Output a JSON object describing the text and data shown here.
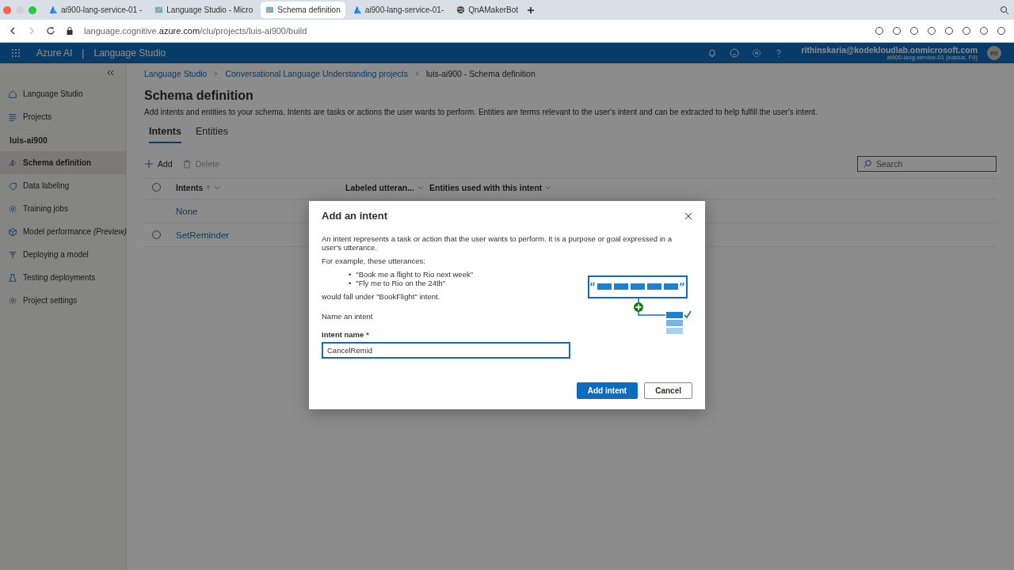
{
  "browser": {
    "tabs": [
      {
        "title": "ai900-lang-service-01 -",
        "kind": "azure",
        "selected": false
      },
      {
        "title": "Language Studio - Micro",
        "kind": "studio",
        "selected": false
      },
      {
        "title": "Schema definition",
        "kind": "studio",
        "selected": true
      },
      {
        "title": "ai900-lang-service-01-",
        "kind": "azure",
        "selected": false
      },
      {
        "title": "QnAMakerBot",
        "kind": "globe",
        "selected": false
      }
    ],
    "url": "language.cognitive.**azure.com**/clu/projects/luis-ai900/build"
  },
  "header": {
    "brand": "Azure AI",
    "separator": "|",
    "product": "Language Studio",
    "user_email": "rithinskaria@kodekloudlab.onmicrosoft.com",
    "user_detail": "ai900-lang-service-01 (eastus, F0)",
    "avatar": "RS"
  },
  "sidebar": {
    "items": [
      {
        "kind": "home",
        "label": "Language Studio",
        "selected": false
      },
      {
        "kind": "list",
        "label": "Projects",
        "selected": false
      },
      {
        "kind": "heading",
        "label": "luis-ai900"
      },
      {
        "kind": "schema",
        "label": "Schema definition",
        "selected": true
      },
      {
        "kind": "tag",
        "label": "Data labeling",
        "selected": false
      },
      {
        "kind": "gear",
        "label": "Training jobs",
        "selected": false
      },
      {
        "kind": "cube",
        "label": "Model performance *(Preview)*",
        "selected": false
      },
      {
        "kind": "deploy",
        "label": "Deploying a model",
        "selected": false
      },
      {
        "kind": "flask",
        "label": "Testing deployments",
        "selected": false
      },
      {
        "kind": "gear",
        "label": "Project settings",
        "selected": false
      }
    ]
  },
  "breadcrumb": [
    {
      "label": "Language Studio",
      "link": true
    },
    {
      "label": "Conversational Language Understanding projects",
      "link": true
    },
    {
      "label": "luis-ai900 - Schema definition",
      "link": false
    }
  ],
  "page": {
    "title": "Schema definition",
    "description": "Add intents and entities to your schema. Intents are tasks or actions the user wants to perform. Entities are terms relevant to the user's intent and can be extracted to help fulfill the user's intent.",
    "tabs": [
      {
        "label": "Intents",
        "selected": true
      },
      {
        "label": "Entities",
        "selected": false
      }
    ],
    "toolbar": [
      {
        "kind": "add",
        "label": "Add",
        "disabled": false
      },
      {
        "kind": "delete",
        "label": "Delete",
        "disabled": true
      }
    ],
    "search": {
      "placeholder": "Search"
    }
  },
  "table": {
    "all_selected": false,
    "columns": [
      {
        "label": "Intents",
        "sorted": true
      },
      {
        "label": "Labeled utteran...",
        "sorted": false
      },
      {
        "label": "Entities used with this intent",
        "sorted": false
      }
    ],
    "rows": [
      {
        "name": "None",
        "selectable": false
      },
      {
        "name": "SetReminder",
        "selectable": true
      }
    ]
  },
  "dialog": {
    "title": "Add an intent",
    "description": "An intent represents a task or action that the user wants to perform. It is a purpose or goal expressed in a user's utterance.",
    "example_intro": "For example, these utterances:",
    "bullet": "•",
    "examples": [
      "\"Book me a flight to Rio next week\"",
      "\"Fly me to Rio on the 24th\""
    ],
    "example_outro": "would fall under \"BookFlight\" intent.",
    "section": "Name an intent",
    "field_label": "Intent name",
    "required_mark": "*",
    "field_value": "CancelRemid",
    "buttons": [
      {
        "label": "Add intent",
        "kind": "primary"
      },
      {
        "label": "Cancel",
        "kind": "secondary"
      }
    ]
  }
}
